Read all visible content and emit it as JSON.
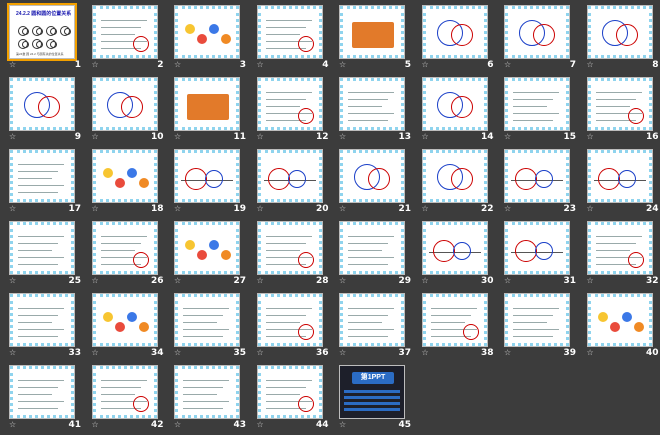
{
  "title_slide": {
    "heading": "24.2.2  圆和圆的位置关系",
    "footer": "第24章  圆  24.2  与圆有关的位置关系"
  },
  "slide1_logo_text": "第1PPT",
  "slides": [
    {
      "number": "1",
      "selected": true
    },
    {
      "number": "2"
    },
    {
      "number": "3"
    },
    {
      "number": "4"
    },
    {
      "number": "5"
    },
    {
      "number": "6"
    },
    {
      "number": "7"
    },
    {
      "number": "8"
    },
    {
      "number": "9"
    },
    {
      "number": "10"
    },
    {
      "number": "11"
    },
    {
      "number": "12"
    },
    {
      "number": "13"
    },
    {
      "number": "14"
    },
    {
      "number": "15"
    },
    {
      "number": "16"
    },
    {
      "number": "17"
    },
    {
      "number": "18"
    },
    {
      "number": "19"
    },
    {
      "number": "20"
    },
    {
      "number": "21"
    },
    {
      "number": "22"
    },
    {
      "number": "23"
    },
    {
      "number": "24"
    },
    {
      "number": "25"
    },
    {
      "number": "26"
    },
    {
      "number": "27"
    },
    {
      "number": "28"
    },
    {
      "number": "29"
    },
    {
      "number": "30"
    },
    {
      "number": "31"
    },
    {
      "number": "32"
    },
    {
      "number": "33"
    },
    {
      "number": "34"
    },
    {
      "number": "35"
    },
    {
      "number": "36"
    },
    {
      "number": "37"
    },
    {
      "number": "38"
    },
    {
      "number": "39"
    },
    {
      "number": "40"
    },
    {
      "number": "41"
    },
    {
      "number": "42"
    },
    {
      "number": "43"
    },
    {
      "number": "44"
    },
    {
      "number": "45"
    }
  ],
  "colors": {
    "background": "#3c3c3c",
    "selection": "#f2a000",
    "border_dots": "#8fd4ee"
  }
}
